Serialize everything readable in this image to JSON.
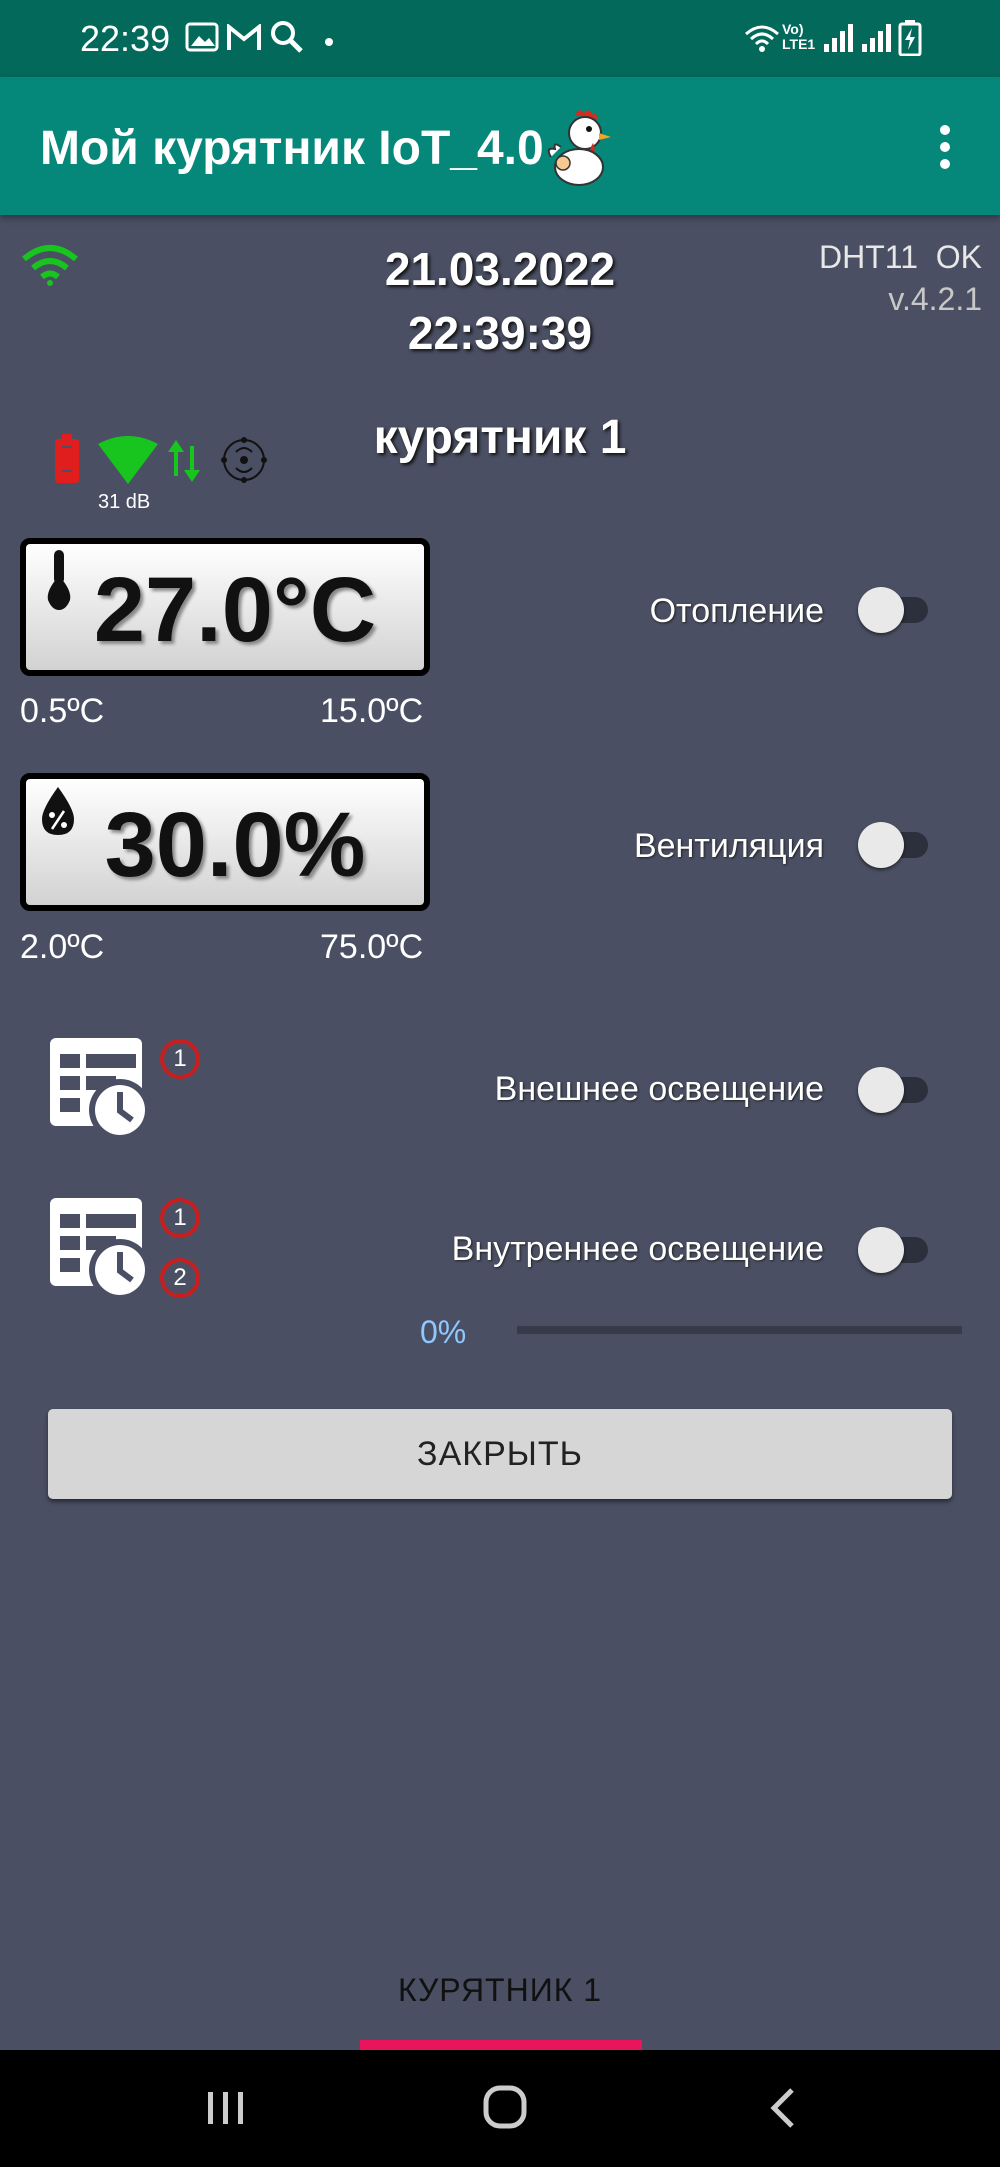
{
  "status_bar": {
    "time": "22:39",
    "network_label": "Vo) LTE1"
  },
  "app_bar": {
    "title": "Мой курятник IoT_4.0",
    "menu_icon": "more-vert-icon"
  },
  "header": {
    "date": "21.03.2022",
    "time": "22:39:39",
    "sensor_name": "DHT11",
    "sensor_status": "OK",
    "version": "v.4.2.1"
  },
  "room": {
    "name": "курятник 1",
    "signal": "31 dB"
  },
  "temperature": {
    "value": "27.0°C",
    "min": "0.5ºC",
    "max": "15.0ºC"
  },
  "humidity": {
    "value": "30.0%",
    "min": "2.0ºC",
    "max": "75.0ºC"
  },
  "controls": {
    "heating": {
      "label": "Отопление",
      "on": false
    },
    "ventilation": {
      "label": "Вентиляция",
      "on": false
    },
    "outdoor_light": {
      "label": "Внешнее освещение",
      "on": false,
      "schedules": [
        "1"
      ]
    },
    "indoor_light": {
      "label": "Внутреннее освещение",
      "on": false,
      "schedules": [
        "1",
        "2"
      ]
    }
  },
  "dimmer": {
    "label": "0%",
    "value": 0
  },
  "close_button": "ЗАКРЫТЬ",
  "tabs": [
    "КУРЯТНИК 1"
  ],
  "colors": {
    "background": "#4a4f63",
    "app_bar": "#05877a",
    "status_bar": "#02695b",
    "wifi_green": "#18c41e",
    "badge_red": "#c81e1e",
    "tab_indicator": "#e8145c",
    "progress": "#8fc7ff"
  }
}
